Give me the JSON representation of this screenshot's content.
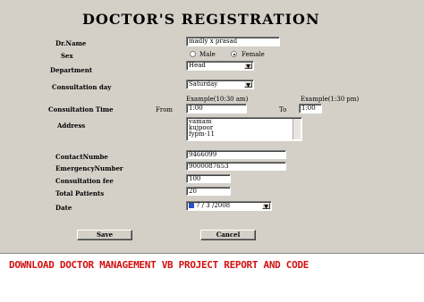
{
  "form": {
    "title": "DOCTOR'S REGISTRATION",
    "fields": {
      "dr_name": {
        "label": "Dr.Name",
        "value": "madly x prasad"
      },
      "sex": {
        "label": "Sex",
        "options": [
          "Male",
          "Female"
        ],
        "selected": "Female"
      },
      "department": {
        "label": "Department",
        "value": "Head"
      },
      "consultation_day": {
        "label": "Consultation day",
        "value": "Saturday"
      },
      "consultation_time": {
        "label": "Consultation Time",
        "from_label": "From",
        "to_label": "To",
        "from_hint": "Example(10:30 am)",
        "to_hint": "Example(1:30 pm)",
        "from_value": "1:00",
        "to_value": "1:00"
      },
      "address": {
        "label": "Address",
        "lines": [
          "vamam",
          "kujpoor",
          "fypm-11"
        ]
      },
      "contact_number": {
        "label": "ContactNumbe",
        "value": "9466099"
      },
      "emergency_number": {
        "label": "EmergencyNumber",
        "value": "9000087653"
      },
      "consultation_fee": {
        "label": "Consultation fee",
        "value": "100"
      },
      "total_patients": {
        "label": "Total Patients",
        "value": "20"
      },
      "date": {
        "label": "Date",
        "value": "7 / 3 /2008"
      }
    },
    "buttons": {
      "save": "Save",
      "cancel": "Cancel"
    }
  },
  "banner": {
    "text": "DOWNLOAD DOCTOR MANAGEMENT VB PROJECT REPORT AND CODE"
  },
  "icons": {
    "dropdown": "chevron-down-icon",
    "calendar": "calendar-icon"
  },
  "colors": {
    "form_bg": "#d4d0c8",
    "banner_text": "#d11010"
  }
}
